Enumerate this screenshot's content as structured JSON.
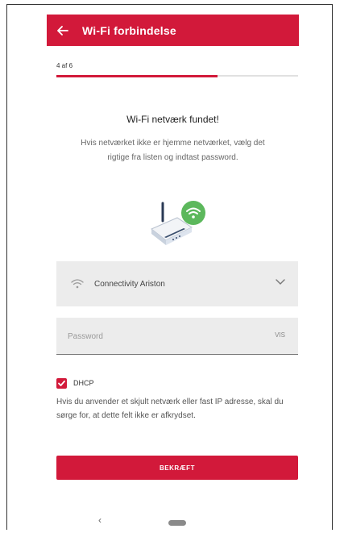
{
  "app": {
    "title": "Wi-Fi forbindelse"
  },
  "icons": {
    "back": "arrow-left-icon",
    "wifi": "wifi-icon",
    "dropdown": "chevron-down-icon",
    "router": "router-icon"
  },
  "progress": {
    "label": "4 af 6",
    "current": 4,
    "total": 6,
    "fraction": 0.667
  },
  "content": {
    "heading": "Wi-Fi netværk fundet!",
    "description": "Hvis netværket ikke er hjemme netværket, vælg det rigtige fra listen og indtast password."
  },
  "network": {
    "selected": "Connectivity Ariston"
  },
  "password": {
    "placeholder": "Password",
    "visibility_toggle": "VIS"
  },
  "dhcp": {
    "label": "DHCP",
    "checked": true,
    "info": "Hvis du anvender et skjult netværk eller fast IP adresse, skal du sørge for, at dette felt ikke er afkrydset."
  },
  "actions": {
    "confirm": "BEKRÆFT"
  },
  "navbar": {
    "back_glyph": "‹"
  },
  "colors": {
    "brand": "#d2193a",
    "wifi_badge": "#5cb85c",
    "field_bg": "#ececec"
  }
}
